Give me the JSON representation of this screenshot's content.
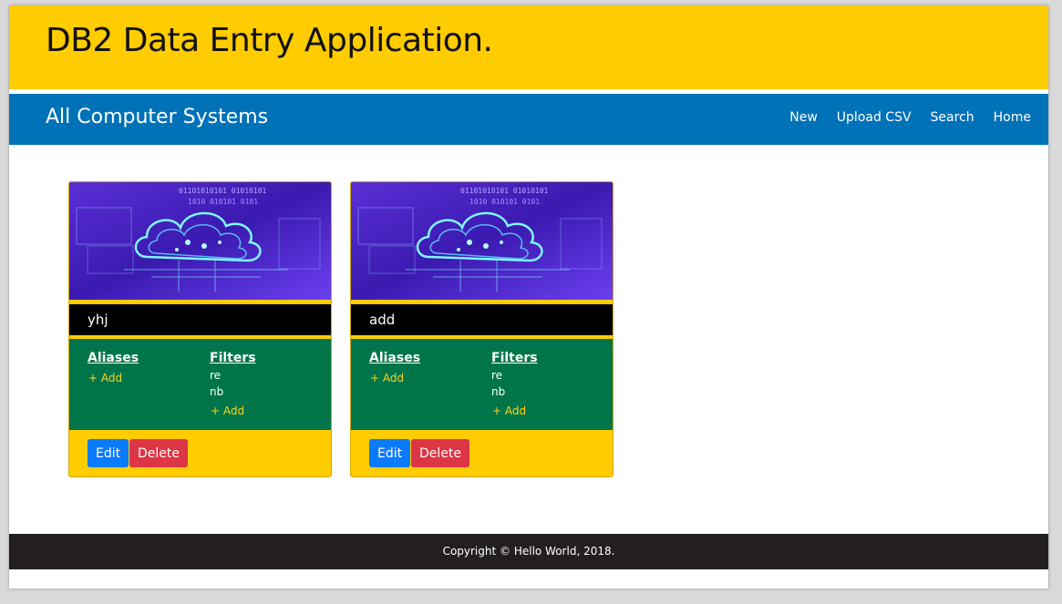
{
  "header": {
    "title": "DB2 Data Entry Application."
  },
  "navbar": {
    "brand": "All Computer Systems",
    "links": [
      "New",
      "Upload CSV",
      "Search",
      "Home"
    ]
  },
  "cards": [
    {
      "title": "yhj",
      "aliases_label": "Aliases",
      "aliases_add": "+ Add",
      "filters_label": "Filters",
      "filters": [
        "re",
        "nb"
      ],
      "filters_add": "+ Add",
      "edit_label": "Edit",
      "delete_label": "Delete"
    },
    {
      "title": "add",
      "aliases_label": "Aliases",
      "aliases_add": "+ Add",
      "filters_label": "Filters",
      "filters": [
        "re",
        "nb"
      ],
      "filters_add": "+ Add",
      "edit_label": "Edit",
      "delete_label": "Delete"
    }
  ],
  "footer": {
    "text": "Copyright © Hello World, 2018."
  },
  "colors": {
    "banner": "#ffcc00",
    "navbar": "#0072b8",
    "card_body": "#00754a",
    "edit_button": "#0a7bff",
    "delete_button": "#dc3545",
    "footer": "#231f20"
  }
}
